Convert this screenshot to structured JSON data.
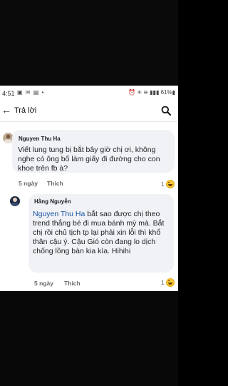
{
  "status_bar": {
    "time": "4:51",
    "left_icons": "▣ ✉ ▤ •",
    "right_icons": "⏰ ✳ ≋ ▮▮▮ 61%▮"
  },
  "header": {
    "title": "Trả lời",
    "back_icon": "back-arrow-icon",
    "search_icon": "search-icon"
  },
  "comments": [
    {
      "author": "Nguyen Thu Ha",
      "text": "Viết lung tung bị bắt bây giờ chị ơi, không nghe có ông bố làm giấy đi đường cho con khoe trên fb à?",
      "time": "5 ngày",
      "like": "Thích",
      "reaction_count": "1"
    },
    {
      "author": "Hằng Nguyễn",
      "mention": "Nguyen Thu Ha",
      "text": " bắt sao được chị theo trend thắng bé đi mua bánh mỳ mà. Bắt chị rồi chủ tịch tp lại phải xin lỗi thì khổ thân cậu ý. Cậu Gió còn đang lo dịch chống lồng bàn kia kìa. Hihihi",
      "time": "5 ngày",
      "like": "Thích",
      "reaction_count": "1"
    }
  ],
  "colors": {
    "mention": "#1a54a5",
    "bubble": "#f0f2f5",
    "meta": "#65676b"
  }
}
